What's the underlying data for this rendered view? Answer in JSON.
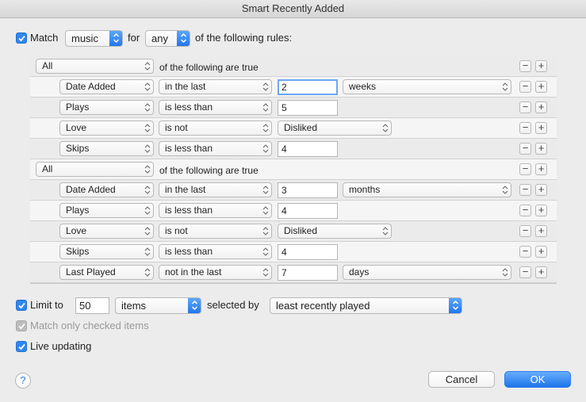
{
  "window": {
    "title": "Smart Recently Added"
  },
  "match": {
    "label": "Match",
    "media": "music",
    "for_label": "for",
    "quantifier": "any",
    "suffix": "of the following rules:"
  },
  "rules": [
    {
      "type": "group",
      "quantifier": "All",
      "text": "of the following are true"
    },
    {
      "type": "rule",
      "field": "Date Added",
      "op": "in the last",
      "value": "2",
      "unit": "weeks",
      "focused": true
    },
    {
      "type": "rule",
      "field": "Plays",
      "op": "is less than",
      "value": "5"
    },
    {
      "type": "rule",
      "field": "Love",
      "op": "is not",
      "choice": "Disliked"
    },
    {
      "type": "rule",
      "field": "Skips",
      "op": "is less than",
      "value": "4"
    },
    {
      "type": "group",
      "quantifier": "All",
      "text": "of the following are true"
    },
    {
      "type": "rule",
      "field": "Date Added",
      "op": "in the last",
      "value": "3",
      "unit": "months"
    },
    {
      "type": "rule",
      "field": "Plays",
      "op": "is less than",
      "value": "4"
    },
    {
      "type": "rule",
      "field": "Love",
      "op": "is not",
      "choice": "Disliked"
    },
    {
      "type": "rule",
      "field": "Skips",
      "op": "is less than",
      "value": "4"
    },
    {
      "type": "rule",
      "field": "Last Played",
      "op": "not in the last",
      "value": "7",
      "unit": "days"
    }
  ],
  "rule_buttons": {
    "remove": "−",
    "add": "+"
  },
  "limit": {
    "label": "Limit to",
    "value": "50",
    "unit": "items",
    "selected_by_label": "selected by",
    "selected_by": "least recently played"
  },
  "options": {
    "match_checked": "Match only checked items",
    "live_updating": "Live updating"
  },
  "buttons": {
    "help": "?",
    "cancel": "Cancel",
    "ok": "OK"
  },
  "colors": {
    "accent": "#2f87f0",
    "disabled": "#bcbcbc"
  }
}
